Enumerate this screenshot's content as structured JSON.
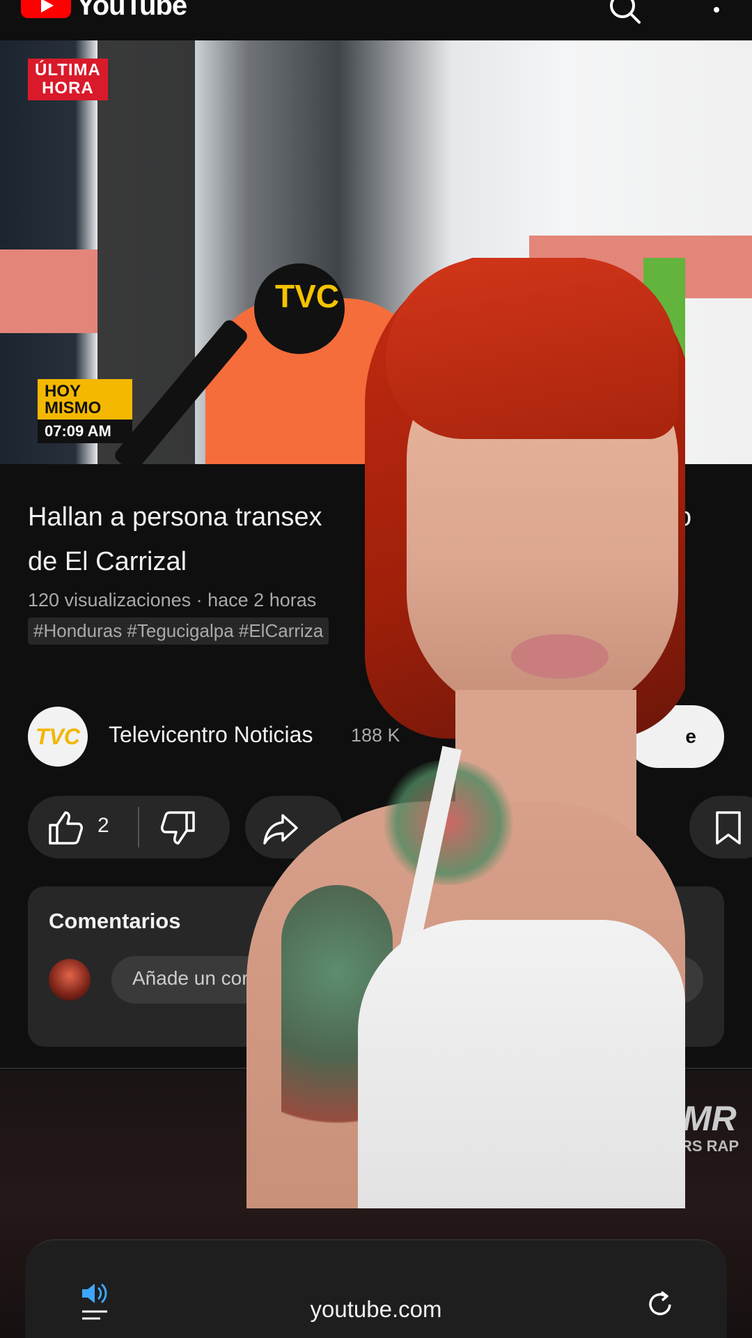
{
  "app": {
    "logo_text": "YouTube"
  },
  "video_overlay": {
    "breaking_badge_line1": "ÚLTIMA",
    "breaking_badge_line2": "HORA",
    "today_badge_line1": "HOY",
    "today_badge_line2": "MISMO",
    "today_badge_time": "07:09 AM",
    "mic_logo": "TVC"
  },
  "video": {
    "title": "Hallan a persona transex",
    "title_line2": "de El Carrizal",
    "title_fragment_right": "o",
    "meta": "120 visualizaciones · hace 2 horas",
    "tags": "#Honduras #Tegucigalpa #ElCarriza"
  },
  "channel": {
    "avatar_text": "TVC",
    "name": "Televicentro Noticias",
    "subscribers": "188 K",
    "subscribe_fragment": "e"
  },
  "actions": {
    "like_count": "2"
  },
  "comments": {
    "label": "Comentarios",
    "input_placeholder": "Añade un cor"
  },
  "next_video": {
    "logo_mr": "MR",
    "logo_rap": "RS RAP"
  },
  "browser": {
    "url": "youtube.com"
  },
  "colors": {
    "brand_red": "#ff0000",
    "background": "#0f0f0f",
    "pill": "#272727"
  },
  "icons": [
    "search-icon",
    "more-vert-icon",
    "like-icon",
    "dislike-icon",
    "share-icon",
    "save-icon",
    "speaker-icon",
    "reload-icon"
  ]
}
